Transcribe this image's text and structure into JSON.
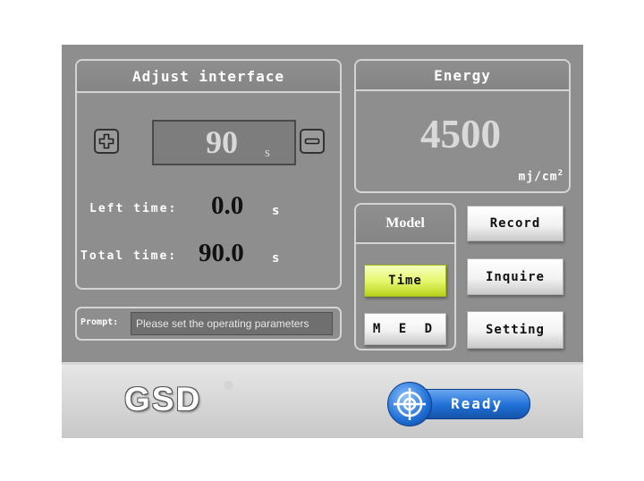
{
  "adjust": {
    "title": "Adjust interface",
    "value": "90",
    "value_unit": "s",
    "left_time_label": "Left time:",
    "left_time_value": "0.0",
    "left_time_unit": "s",
    "total_time_label": "Total time:",
    "total_time_value": "90.0",
    "total_time_unit": "s"
  },
  "energy": {
    "title": "Energy",
    "value": "4500",
    "unit": "mj/cm",
    "unit_sup": "2"
  },
  "model": {
    "title": "Model",
    "options": [
      {
        "label": "Time",
        "selected": true
      },
      {
        "label": "M E D",
        "selected": false
      }
    ]
  },
  "actions": {
    "record": "Record",
    "inquire": "Inquire",
    "setting": "Setting"
  },
  "prompt": {
    "label": "Prompt:",
    "text": "Please set the operating parameters"
  },
  "brand": {
    "logo": "GSD",
    "registered": "®"
  },
  "status": {
    "label": "Ready"
  },
  "colors": {
    "screen_bg": "#8e8e8e",
    "accent_selected": "#e6f870",
    "ready_blue": "#1f6fd6"
  },
  "icons": [
    "plus-icon",
    "minus-icon",
    "target-icon"
  ]
}
